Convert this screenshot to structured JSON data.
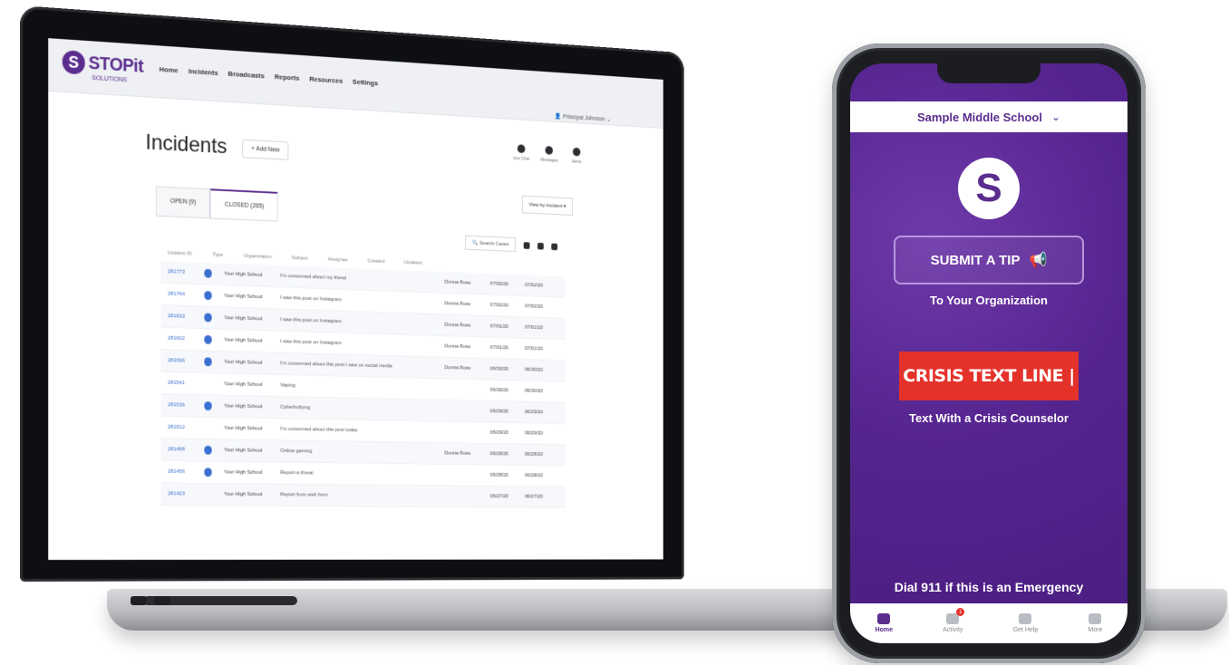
{
  "laptop": {
    "brand": "STOPit",
    "brand_sub": "SOLUTIONS",
    "nav": [
      "Home",
      "Incidents",
      "Broadcasts",
      "Reports",
      "Resources",
      "Settings"
    ],
    "user": "Principal Johnson",
    "page_title": "Incidents",
    "add_button": "+ Add New",
    "header_icons": [
      "Live Chat",
      "Messages",
      "Alerts"
    ],
    "tabs": [
      "OPEN (9)",
      "CLOSED (265)"
    ],
    "filter": "View by Incident",
    "search_placeholder": "Search Cases",
    "columns": [
      "Incident ID",
      "Type",
      "Organization",
      "Subject",
      "Assignee",
      "Created",
      "Updated"
    ],
    "rows": [
      {
        "id": "281773",
        "dot": true,
        "org": "Your High School",
        "subject": "I'm concerned about my friend",
        "assignee": "Donna Ross",
        "created": "07/02/20",
        "updated": "07/02/20"
      },
      {
        "id": "281764",
        "dot": true,
        "org": "Your High School",
        "subject": "I saw this post on Instagram",
        "assignee": "Donna Ross",
        "created": "07/02/20",
        "updated": "07/02/20"
      },
      {
        "id": "281633",
        "dot": true,
        "org": "Your High School",
        "subject": "I saw this post on Instagram",
        "assignee": "Donna Ross",
        "created": "07/01/20",
        "updated": "07/01/20"
      },
      {
        "id": "281602",
        "dot": true,
        "org": "Your High School",
        "subject": "I saw this post on Instagram",
        "assignee": "Donna Ross",
        "created": "07/01/20",
        "updated": "07/01/20"
      },
      {
        "id": "281596",
        "dot": true,
        "org": "Your High School",
        "subject": "I'm concerned about this post I saw on social media",
        "assignee": "Donna Ross",
        "created": "06/30/20",
        "updated": "06/30/20"
      },
      {
        "id": "281541",
        "dot": false,
        "org": "Your High School",
        "subject": "Vaping",
        "assignee": "",
        "created": "06/30/20",
        "updated": "06/30/20"
      },
      {
        "id": "281536",
        "dot": true,
        "org": "Your High School",
        "subject": "Cyberbullying",
        "assignee": "",
        "created": "06/29/20",
        "updated": "06/29/20"
      },
      {
        "id": "281512",
        "dot": false,
        "org": "Your High School",
        "subject": "I'm concerned about this post today",
        "assignee": "",
        "created": "06/29/20",
        "updated": "06/29/20"
      },
      {
        "id": "281498",
        "dot": true,
        "org": "Your High School",
        "subject": "Online gaming",
        "assignee": "Donna Ross",
        "created": "06/28/20",
        "updated": "06/28/20"
      },
      {
        "id": "281456",
        "dot": true,
        "org": "Your High School",
        "subject": "Report a threat",
        "assignee": "",
        "created": "06/28/20",
        "updated": "06/28/20"
      },
      {
        "id": "281423",
        "dot": false,
        "org": "Your High School",
        "subject": "Report from web form",
        "assignee": "",
        "created": "06/27/20",
        "updated": "06/27/20"
      }
    ]
  },
  "phone": {
    "school": "Sample Middle School",
    "submit_tip": "SUBMIT A TIP",
    "submit_tip_sub": "To Your Organization",
    "crisis": "CRISIS TEXT LINE |",
    "crisis_sub": "Text With a Crisis Counselor",
    "emergency": "Dial 911 if this is an Emergency",
    "bottom_nav": [
      "Home",
      "Activity",
      "Get Help",
      "More"
    ],
    "activity_badge": "1"
  },
  "colors": {
    "brand_purple": "#5b2d8e",
    "crisis_red": "#e4322b",
    "link_blue": "#3b6fd1"
  }
}
